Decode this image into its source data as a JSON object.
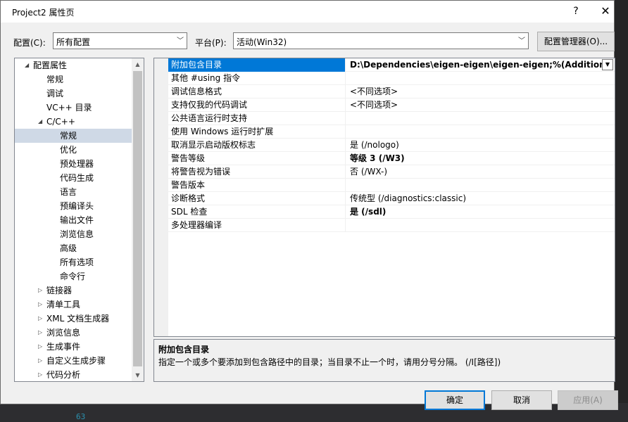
{
  "window": {
    "title": "Project2 属性页",
    "help_glyph": "?",
    "close_glyph": "✕"
  },
  "toolbar": {
    "config_label": "配置(C):",
    "config_value": "所有配置",
    "platform_label": "平台(P):",
    "platform_value": "活动(Win32)",
    "config_manager_label": "配置管理器(O)..."
  },
  "tree": {
    "items": [
      {
        "label": "配置属性",
        "expander": "◢",
        "level": 0
      },
      {
        "label": "常规",
        "level": 1
      },
      {
        "label": "调试",
        "level": 1
      },
      {
        "label": "VC++ 目录",
        "level": 1
      },
      {
        "label": "C/C++",
        "expander": "◢",
        "level": 1
      },
      {
        "label": "常规",
        "level": 2,
        "selected": true
      },
      {
        "label": "优化",
        "level": 2
      },
      {
        "label": "预处理器",
        "level": 2
      },
      {
        "label": "代码生成",
        "level": 2
      },
      {
        "label": "语言",
        "level": 2
      },
      {
        "label": "预编译头",
        "level": 2
      },
      {
        "label": "输出文件",
        "level": 2
      },
      {
        "label": "浏览信息",
        "level": 2
      },
      {
        "label": "高级",
        "level": 2
      },
      {
        "label": "所有选项",
        "level": 2
      },
      {
        "label": "命令行",
        "level": 2
      },
      {
        "label": "链接器",
        "expander": "▷",
        "level": 1
      },
      {
        "label": "清单工具",
        "expander": "▷",
        "level": 1
      },
      {
        "label": "XML 文档生成器",
        "expander": "▷",
        "level": 1
      },
      {
        "label": "浏览信息",
        "expander": "▷",
        "level": 1
      },
      {
        "label": "生成事件",
        "expander": "▷",
        "level": 1
      },
      {
        "label": "自定义生成步骤",
        "expander": "▷",
        "level": 1
      },
      {
        "label": "代码分析",
        "expander": "▷",
        "level": 1
      }
    ]
  },
  "properties": [
    {
      "name": "附加包含目录",
      "value": "D:\\Dependencies\\eigen-eigen\\eigen-eigen;%(AdditionalIn",
      "bold": true,
      "selected": true
    },
    {
      "name": "其他 #using 指令",
      "value": ""
    },
    {
      "name": "调试信息格式",
      "value": "<不同选项>"
    },
    {
      "name": "支持仅我的代码调试",
      "value": "<不同选项>"
    },
    {
      "name": "公共语言运行时支持",
      "value": ""
    },
    {
      "name": "使用 Windows 运行时扩展",
      "value": ""
    },
    {
      "name": "取消显示启动版权标志",
      "value": "是 (/nologo)"
    },
    {
      "name": "警告等级",
      "value": "等级 3 (/W3)",
      "bold": true
    },
    {
      "name": "将警告视为错误",
      "value": "否 (/WX-)"
    },
    {
      "name": "警告版本",
      "value": ""
    },
    {
      "name": "诊断格式",
      "value": "传统型 (/diagnostics:classic)"
    },
    {
      "name": "SDL 检查",
      "value": "是 (/sdl)",
      "bold": true
    },
    {
      "name": "多处理器编译",
      "value": ""
    }
  ],
  "description": {
    "title": "附加包含目录",
    "text": "指定一个或多个要添加到包含路径中的目录；当目录不止一个时，请用分号分隔。     (/I[路径])"
  },
  "buttons": {
    "ok": "确定",
    "cancel": "取消",
    "apply": "应用(A)"
  },
  "background": {
    "line_number": "63"
  },
  "colors": {
    "accent": "#0078d7",
    "tree_selection": "#cfd9e6"
  }
}
